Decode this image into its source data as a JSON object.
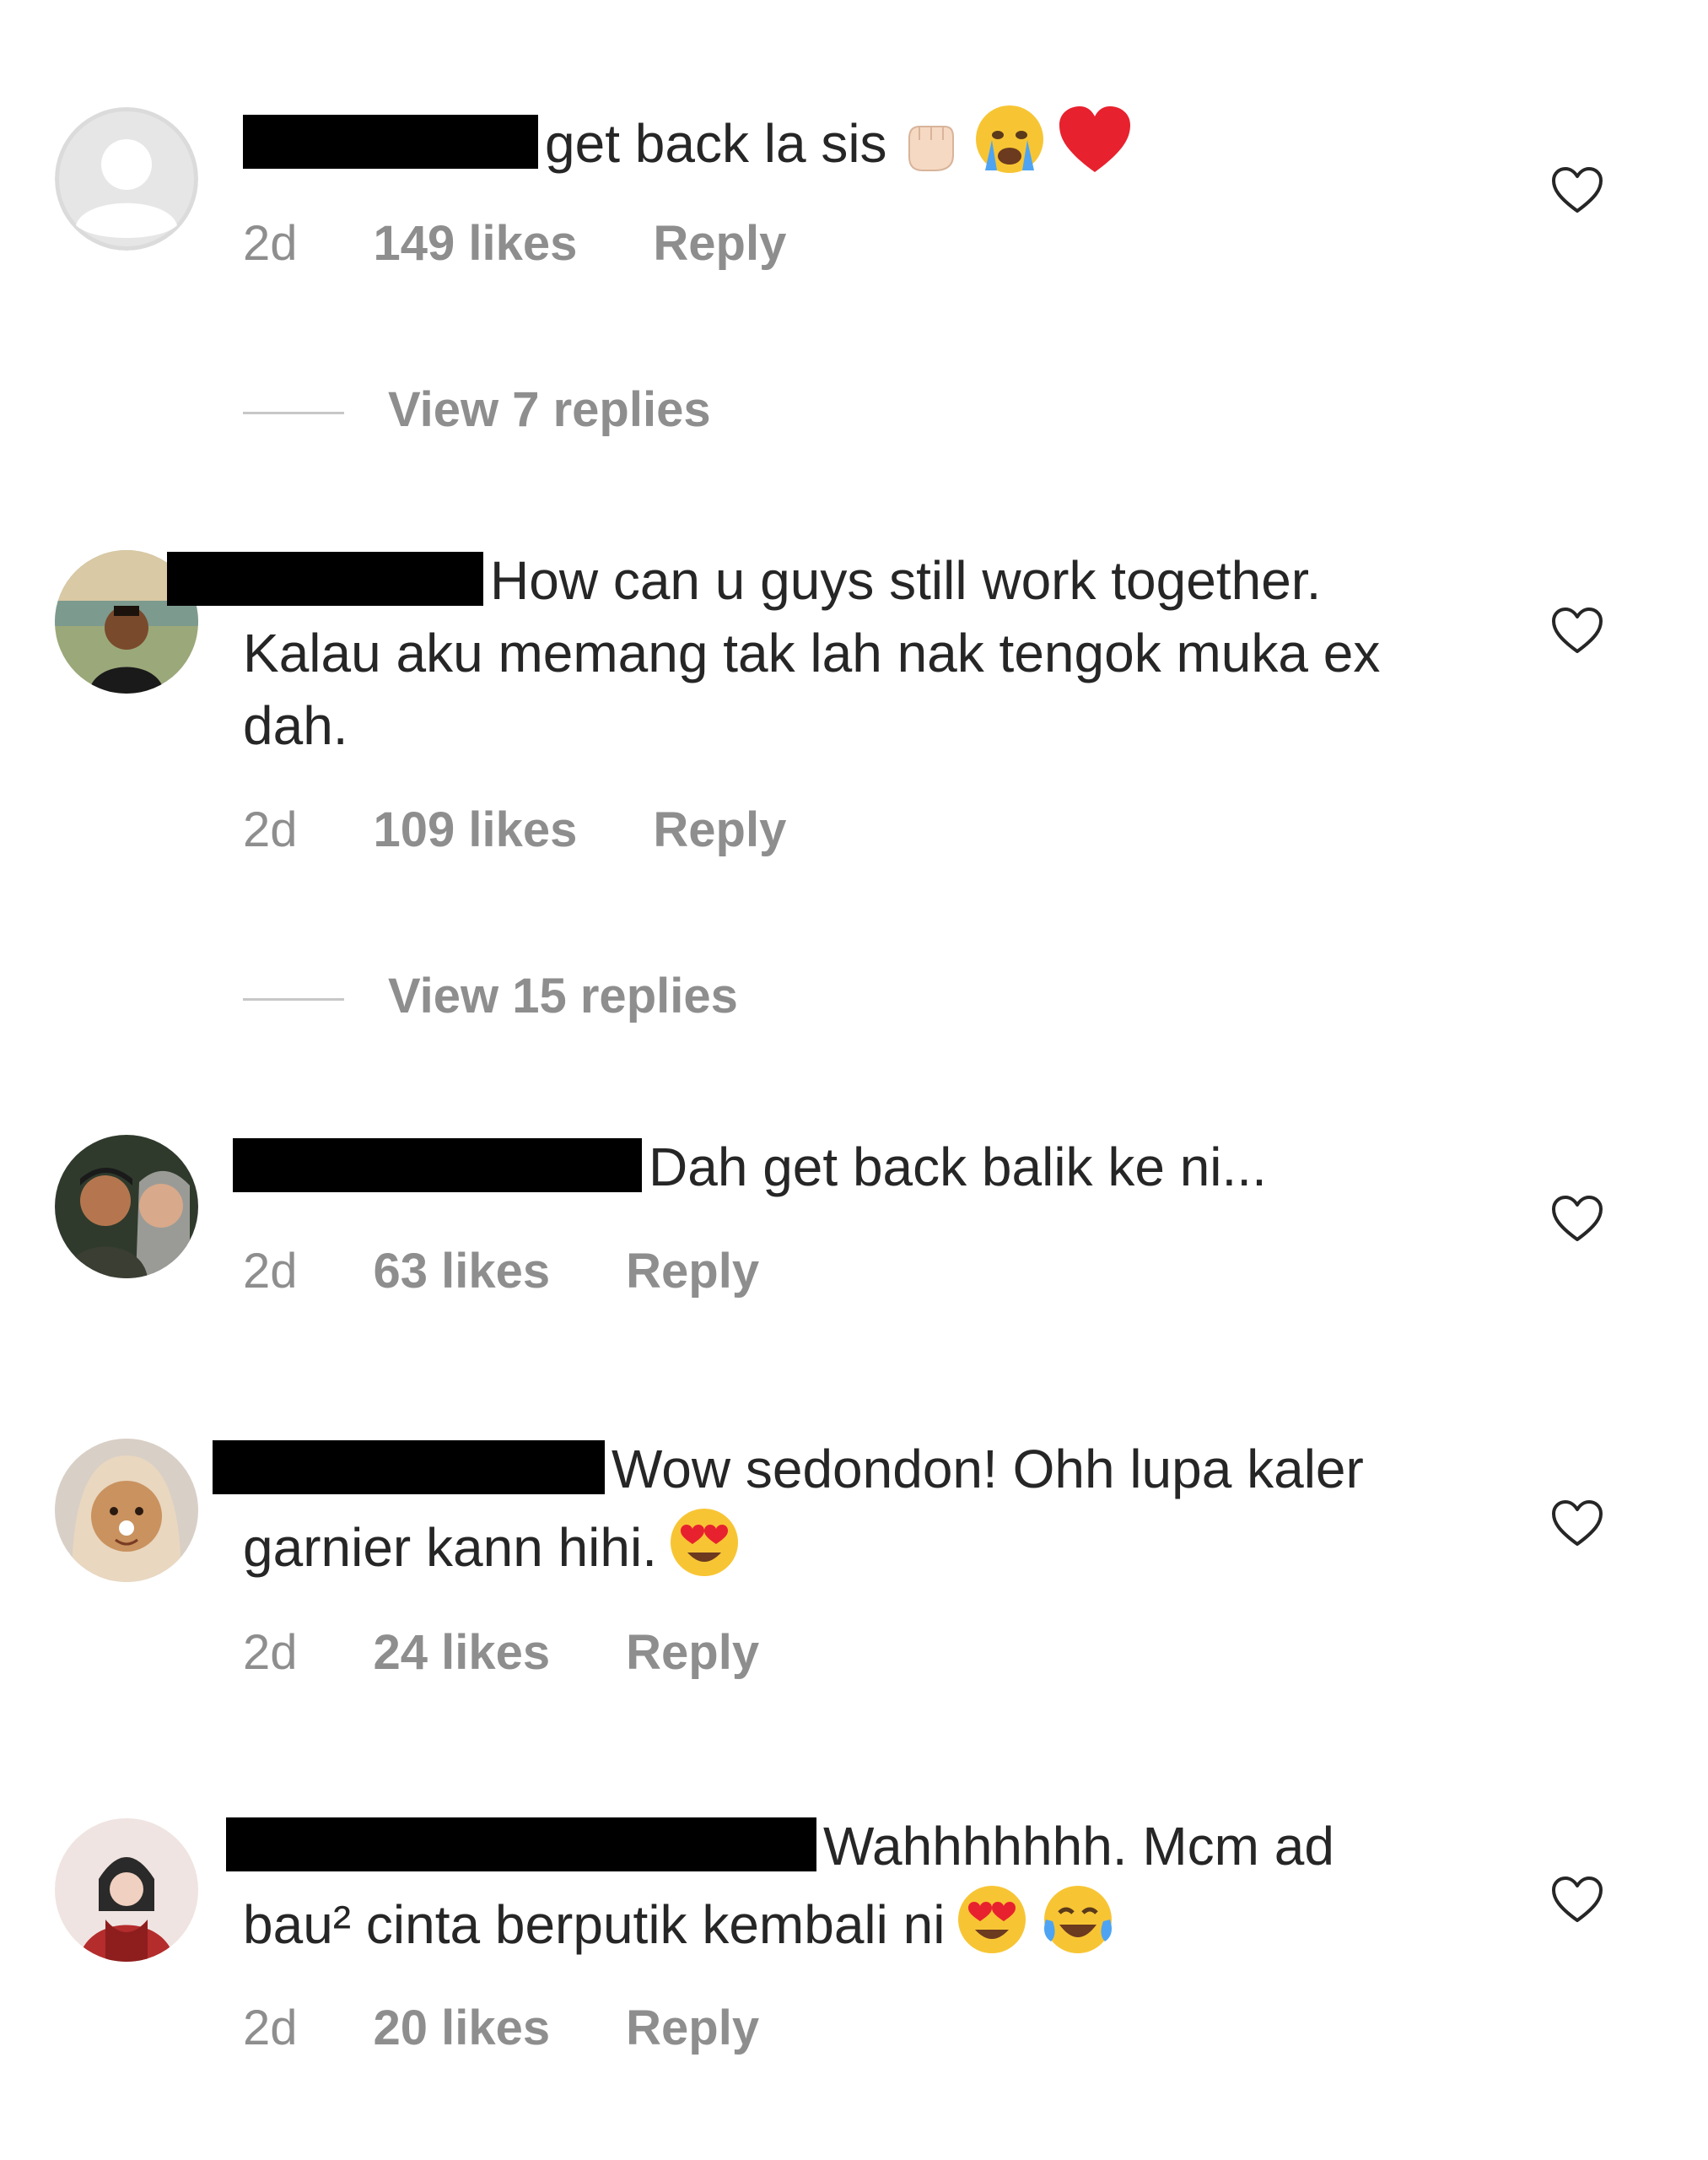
{
  "comments": [
    {
      "text": "get back la sis",
      "emojis": [
        "raised-fist-emoji",
        "crying-face-emoji",
        "red-heart-emoji"
      ],
      "time": "2d",
      "likes": "149 likes",
      "reply": "Reply",
      "view_replies": "View 7 replies"
    },
    {
      "text": "How can u guys still work together. Kalau aku memang tak lah nak tengok muka ex dah.",
      "time": "2d",
      "likes": "109 likes",
      "reply": "Reply",
      "view_replies": "View 15 replies"
    },
    {
      "text": "Dah get back balik ke ni...",
      "time": "2d",
      "likes": "63 likes",
      "reply": "Reply"
    },
    {
      "text": "Wow sedondon! Ohh lupa kaler garnier kann hihi.",
      "emojis": [
        "heart-eyes-emoji"
      ],
      "time": "2d",
      "likes": "24 likes",
      "reply": "Reply"
    },
    {
      "text": "Wahhhhhhh. Mcm ad bau² cinta berputik kembali ni",
      "emojis": [
        "heart-eyes-emoji",
        "tears-of-joy-emoji"
      ],
      "time": "2d",
      "likes": "20 likes",
      "reply": "Reply"
    }
  ],
  "colors": {
    "text": "#262626",
    "meta": "#8e8e8e",
    "divider": "#c7c7c7"
  }
}
